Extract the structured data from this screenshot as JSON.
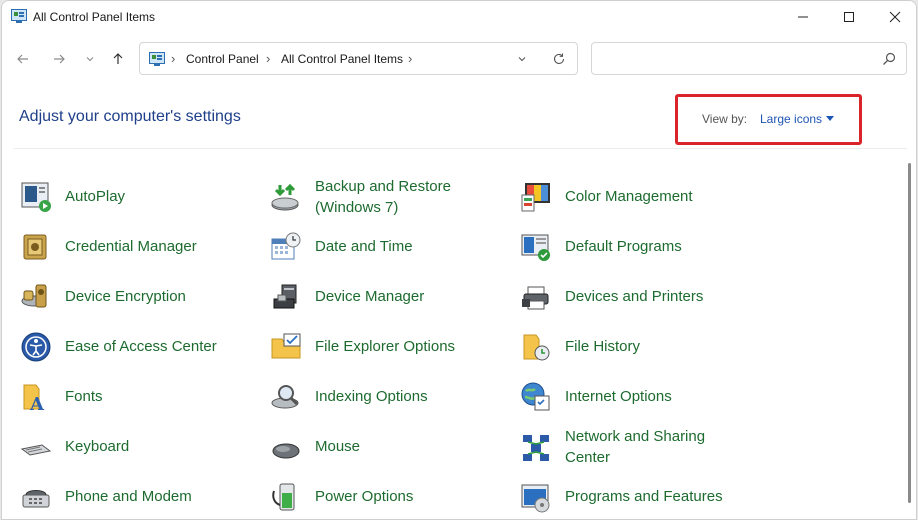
{
  "window": {
    "title": "All Control Panel Items"
  },
  "breadcrumb": [
    "Control Panel",
    "All Control Panel Items"
  ],
  "search": {
    "placeholder": ""
  },
  "header": {
    "title": "Adjust your computer's settings",
    "view_by_label": "View by:",
    "view_by_value": "Large icons"
  },
  "items": [
    {
      "label": "AutoPlay",
      "label2": "",
      "icon": "autoplay-icon"
    },
    {
      "label": "Backup and Restore",
      "label2": "(Windows 7)",
      "icon": "backup-restore-icon"
    },
    {
      "label": "Color Management",
      "label2": "",
      "icon": "color-management-icon"
    },
    {
      "label": "Credential Manager",
      "label2": "",
      "icon": "credential-manager-icon"
    },
    {
      "label": "Date and Time",
      "label2": "",
      "icon": "date-time-icon"
    },
    {
      "label": "Default Programs",
      "label2": "",
      "icon": "default-programs-icon"
    },
    {
      "label": "Device Encryption",
      "label2": "",
      "icon": "device-encryption-icon"
    },
    {
      "label": "Device Manager",
      "label2": "",
      "icon": "device-manager-icon"
    },
    {
      "label": "Devices and Printers",
      "label2": "",
      "icon": "devices-printers-icon"
    },
    {
      "label": "Ease of Access Center",
      "label2": "",
      "icon": "ease-of-access-icon"
    },
    {
      "label": "File Explorer Options",
      "label2": "",
      "icon": "file-explorer-options-icon"
    },
    {
      "label": "File History",
      "label2": "",
      "icon": "file-history-icon"
    },
    {
      "label": "Fonts",
      "label2": "",
      "icon": "fonts-icon"
    },
    {
      "label": "Indexing Options",
      "label2": "",
      "icon": "indexing-options-icon"
    },
    {
      "label": "Internet Options",
      "label2": "",
      "icon": "internet-options-icon"
    },
    {
      "label": "Keyboard",
      "label2": "",
      "icon": "keyboard-icon"
    },
    {
      "label": "Mouse",
      "label2": "",
      "icon": "mouse-icon"
    },
    {
      "label": "Network and Sharing",
      "label2": "Center",
      "icon": "network-sharing-icon"
    },
    {
      "label": "Phone and Modem",
      "label2": "",
      "icon": "phone-modem-icon"
    },
    {
      "label": "Power Options",
      "label2": "",
      "icon": "power-options-icon"
    },
    {
      "label": "Programs and Features",
      "label2": "",
      "icon": "programs-features-icon"
    }
  ]
}
